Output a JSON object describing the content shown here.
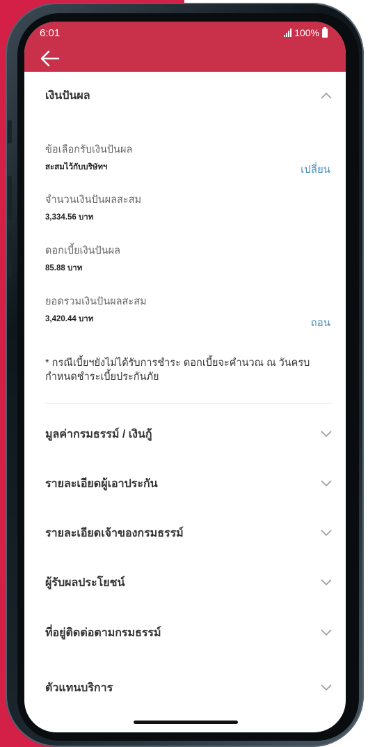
{
  "status_bar": {
    "time": "6:01",
    "battery": "100%"
  },
  "header": {
    "back_icon": "arrow-left-icon",
    "accent_color": "#c9304a"
  },
  "expanded_section": {
    "title": "เงินปันผล",
    "fields": [
      {
        "label": "ข้อเลือกรับเงินปันผล",
        "value": "สะสมไว้กับบริษัทฯ",
        "action": "เปลี่ยน"
      },
      {
        "label": "จำนวนเงินปันผลสะสม",
        "value": "3,334.56 บาท"
      },
      {
        "label": "ดอกเบี้ยเงินปันผล",
        "value": "85.88 บาท"
      },
      {
        "label": "ยอดรวมเงินปันผลสะสม",
        "value": "3,420.44 บาท",
        "action": "ถอน"
      }
    ],
    "note": "* กรณีเบี้ยฯยังไม่ได้รับการชำระ ดอกเบี้ยจะคำนวณ ณ วันครบกำหนดชำระเบี้ยประกันภัย"
  },
  "collapsed_sections": [
    {
      "title": "มูลค่ากรมธรรม์ / เงินกู้"
    },
    {
      "title": "รายละเอียดผู้เอาประกัน"
    },
    {
      "title": "รายละเอียดเจ้าของกรมธรรม์"
    },
    {
      "title": "ผู้รับผลประโยชน์"
    },
    {
      "title": "ที่อยู่ติดต่อตามกรมธรรม์"
    },
    {
      "title": "ตัวแทนบริการ"
    }
  ]
}
